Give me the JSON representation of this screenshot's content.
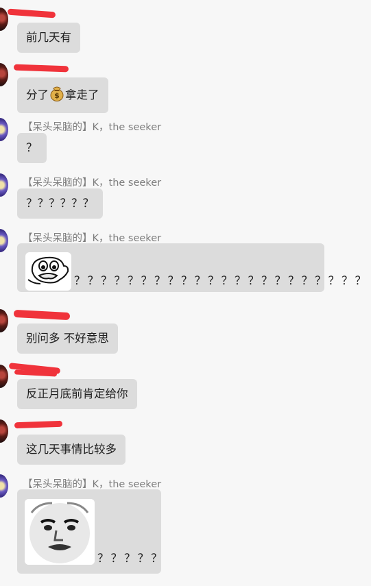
{
  "messages": [
    {
      "sender": "",
      "text": "前几天有"
    },
    {
      "sender": "",
      "text_before": "分了",
      "text_after": "拿走了",
      "emoji": "money-bag"
    },
    {
      "sender": "【呆头呆脑的】K，the seeker",
      "text": "？"
    },
    {
      "sender": "【呆头呆脑的】K，the seeker",
      "text": "？？？？？？"
    },
    {
      "sender": "【呆头呆脑的】K，the seeker",
      "sticker": "confused-face-sticker",
      "text": "？？？？？？？？？？？？？？？？？？？？？？"
    },
    {
      "sender": "",
      "text": "别问多 不好意思"
    },
    {
      "sender": "",
      "text": "反正月底前肯定给你"
    },
    {
      "sender": "",
      "text": "这几天事情比较多"
    },
    {
      "sender": "【呆头呆脑的】K，the seeker",
      "sticker": "meme-face-sticker",
      "text": "？？？？？"
    }
  ],
  "colors": {
    "background": "#f7f7f7",
    "bubble": "#dcdcdc",
    "sender_name": "#7d7d7d",
    "redaction": "#f0333b"
  }
}
